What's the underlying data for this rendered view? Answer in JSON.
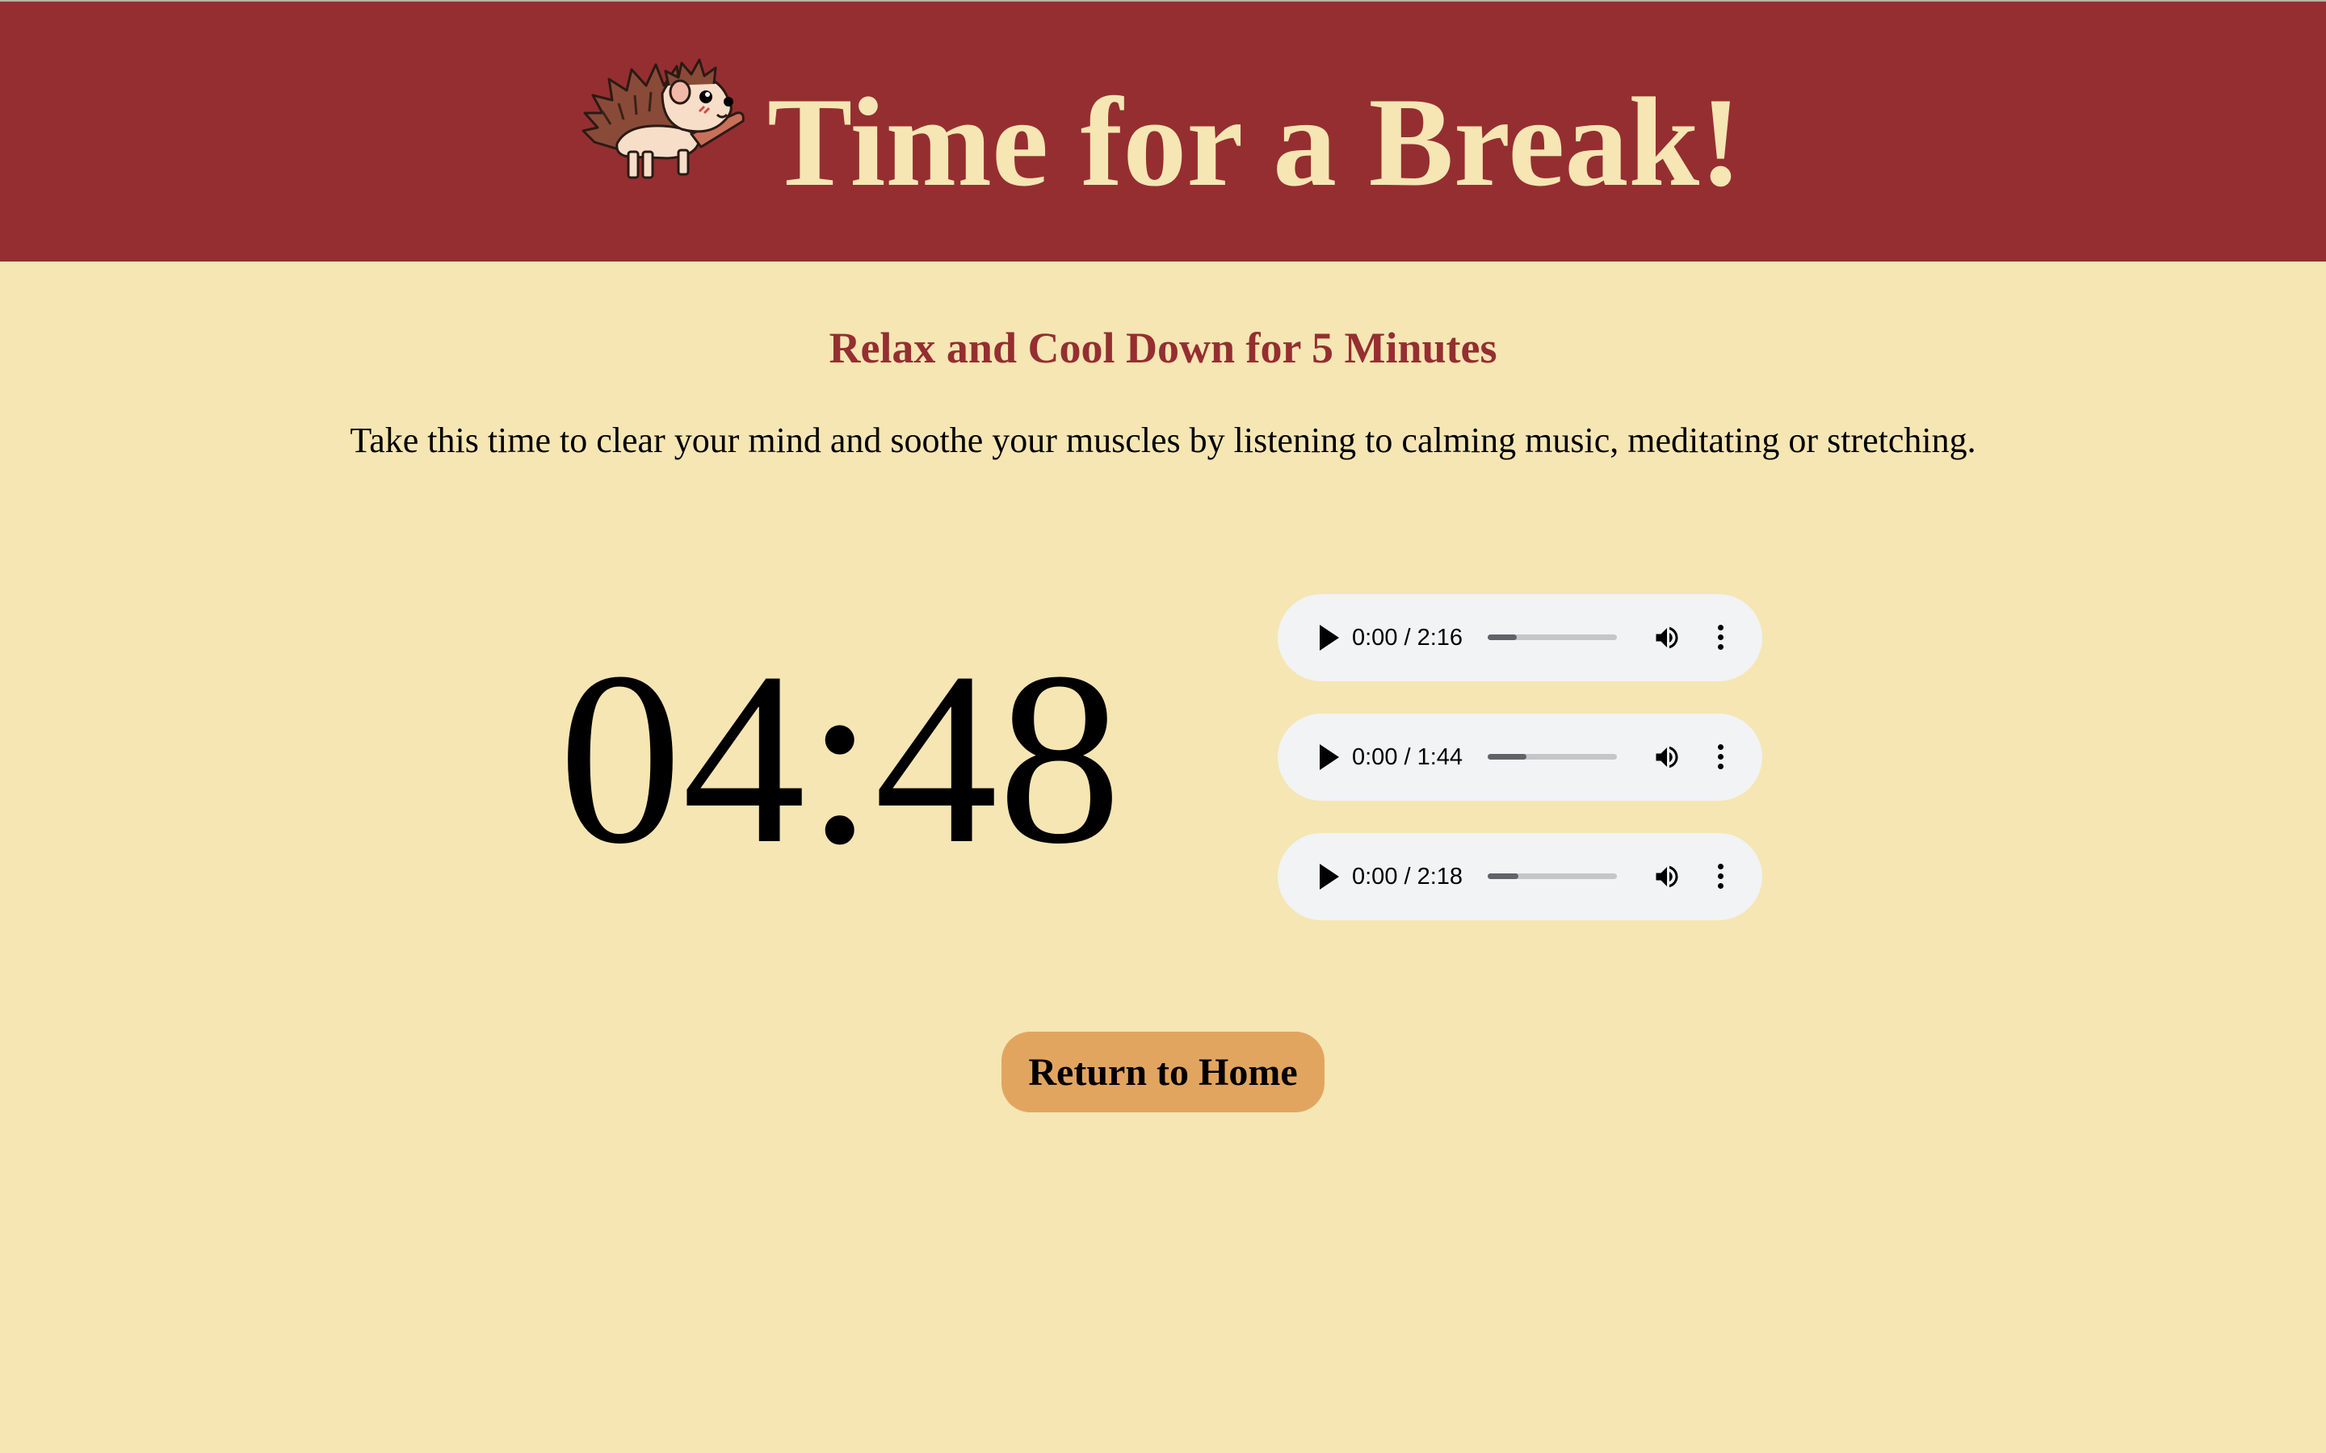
{
  "header": {
    "title": "Time for a Break!",
    "mascot_icon": "hedgehog-icon",
    "background_color": "#952e31",
    "title_color": "#f5e6b3"
  },
  "main": {
    "subtitle": "Relax and Cool Down for 5 Minutes",
    "description": "Take this time to clear your mind and soothe your muscles by listening to calming music, meditating or stretching.",
    "background_color": "#f5e6b3"
  },
  "timer": {
    "display": "04:48"
  },
  "audio_players": [
    {
      "time_display": "0:00 / 2:16",
      "progress_fraction": 0.0
    },
    {
      "time_display": "0:00 / 1:44",
      "progress_fraction": 0.0
    },
    {
      "time_display": "0:00 / 2:18",
      "progress_fraction": 0.0
    }
  ],
  "buttons": {
    "return_home_label": "Return to Home",
    "return_home_color": "#e2a560"
  }
}
